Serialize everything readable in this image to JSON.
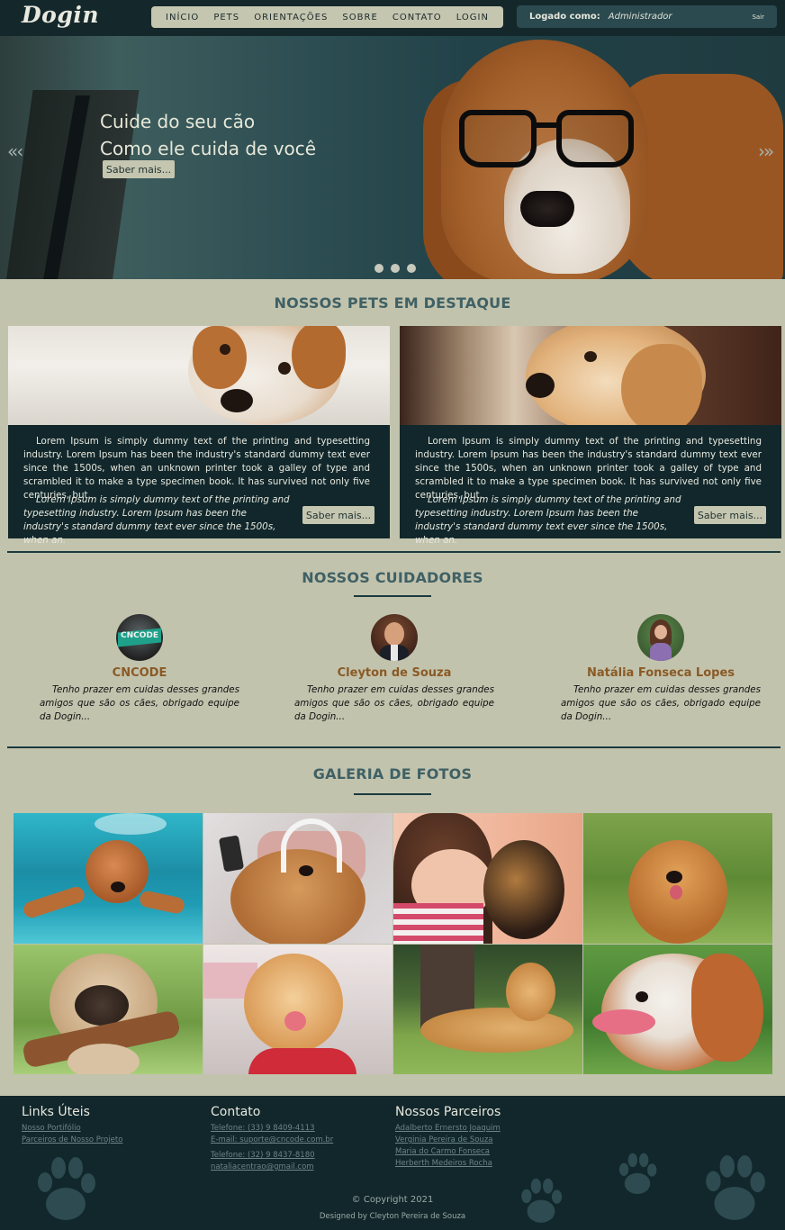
{
  "header": {
    "logo": "Dogin",
    "nav": [
      "INÍCIO",
      "PETS",
      "ORIENTAÇÕES",
      "SOBRE",
      "CONTATO",
      "LOGIN"
    ],
    "login_label": "Logado como:",
    "login_user": "Administrador",
    "logout": "Sair"
  },
  "hero": {
    "line1": "Cuide do seu cão",
    "line2": "Como ele cuida de você",
    "button": "Saber mais...",
    "prev": "«‹",
    "next": "›»",
    "slide_count": 3
  },
  "featured": {
    "title": "NOSSOS PETS EM DESTAQUE",
    "cards": [
      {
        "text": "Lorem Ipsum is simply dummy text of the printing and typesetting industry. Lorem Ipsum has been the industry's standard dummy text ever since the 1500s, when an unknown printer took a galley of type and scrambled it to make a type specimen book. It has survived not only five centuries, but.",
        "italic": "Lorem Ipsum is simply dummy text of the printing and typesetting industry. Lorem Ipsum has been the industry's standard dummy text ever since the 1500s, when an.",
        "button": "Saber mais..."
      },
      {
        "text": "Lorem Ipsum is simply dummy text of the printing and typesetting industry. Lorem Ipsum has been the industry's standard dummy text ever since the 1500s, when an unknown printer took a galley of type and scrambled it to make a type specimen book. It has survived not only five centuries, but.",
        "italic": "Lorem Ipsum is simply dummy text of the printing and typesetting industry. Lorem Ipsum has been the industry's standard dummy text ever since the 1500s, when an.",
        "button": "Saber mais..."
      }
    ]
  },
  "carers": {
    "title": "NOSSOS CUIDADORES",
    "people": [
      {
        "name": "CNCODE",
        "avatar_text": "CNCODE",
        "quote": "Tenho prazer em cuidas desses grandes amigos que são os cães, obrigado equipe da Dogin..."
      },
      {
        "name": "Cleyton de Souza",
        "quote": "Tenho prazer em cuidas desses grandes amigos que são os cães, obrigado equipe da Dogin..."
      },
      {
        "name": "Natália Fonseca Lopes",
        "quote": "Tenho prazer em cuidas desses grandes amigos que são os cães, obrigado equipe da Dogin..."
      }
    ]
  },
  "gallery": {
    "title": "GALERIA DE FOTOS"
  },
  "footer": {
    "links_title": "Links Úteis",
    "links": [
      "Nosso Portifólio",
      "Parceiros de Nosso Projeto"
    ],
    "contact_title": "Contato",
    "contact": [
      "Telefone: (33) 9 8409-4113",
      "E-mail: suporte@cncode.com.br",
      "Telefone: (32) 9 8437-8180",
      "nataliacentrao@gmail.com"
    ],
    "partners_title": "Nossos Parceiros",
    "partners": [
      "Adalberto Ernersto Joaquim",
      "Verginia Pereira de Souza",
      "Maria do Carmo Fonseca",
      "Herberth Medeiros Rocha"
    ],
    "copyright": "© Copyright 2021",
    "designed": "Designed by Cleyton Pereira de Souza"
  },
  "colors": {
    "background": "#c2c3ad",
    "dark": "#11272b",
    "accent_title": "#3f6165",
    "name_color": "#8a5a25"
  },
  "icons": [
    "paw-icon"
  ]
}
